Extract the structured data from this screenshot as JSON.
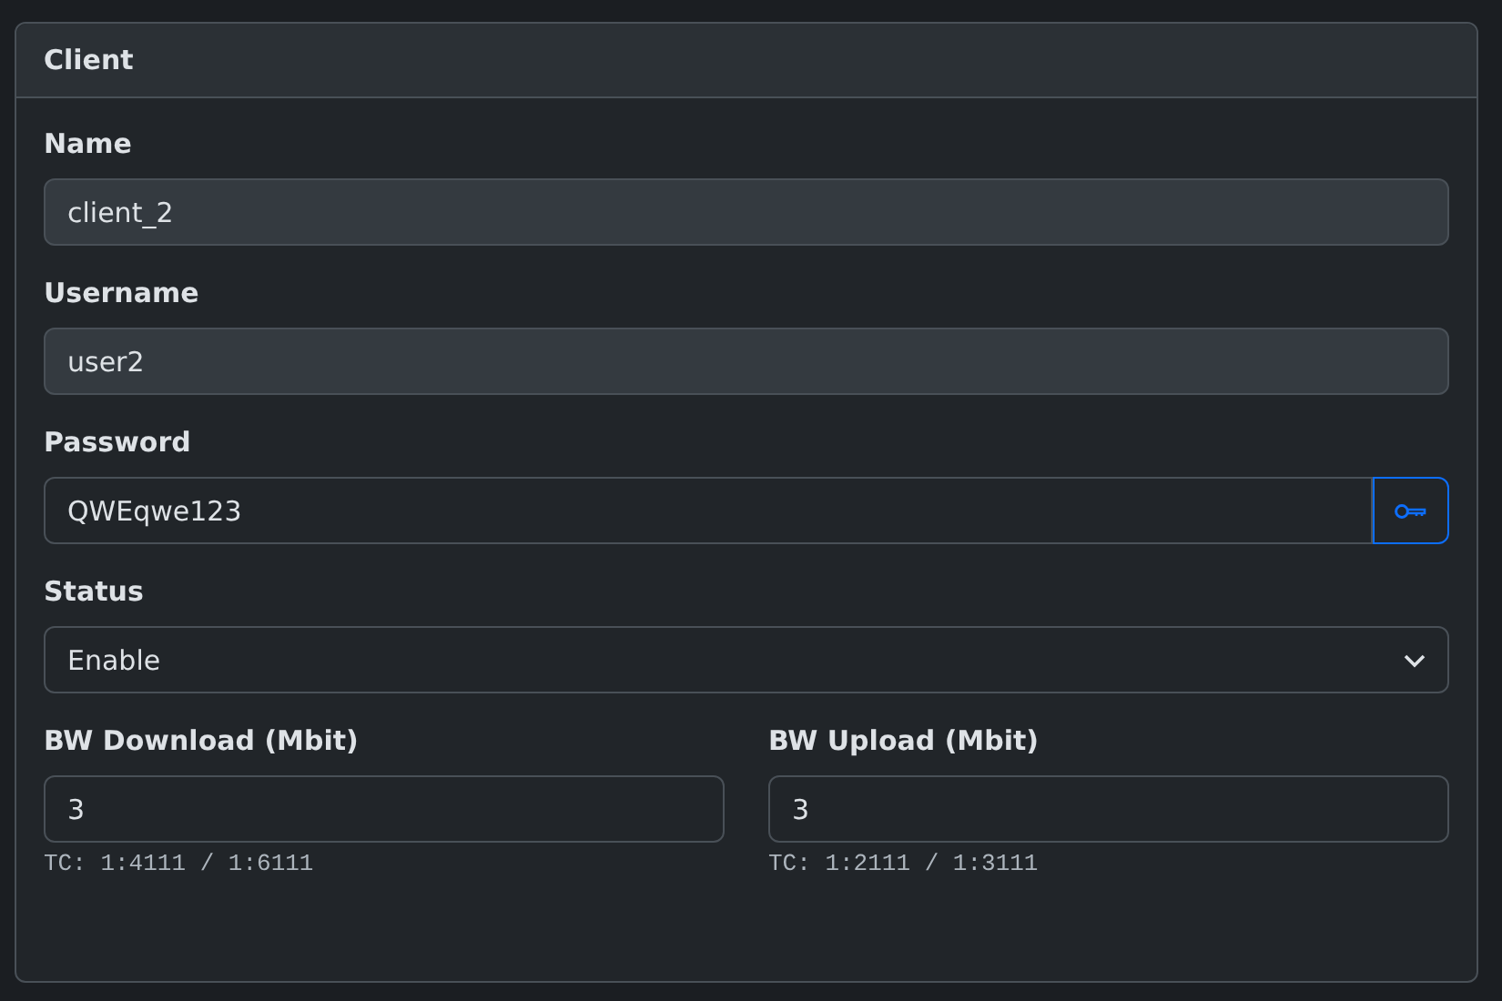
{
  "card": {
    "title": "Client"
  },
  "fields": [
    {
      "kind": "text",
      "label": "Name",
      "value": "client_2",
      "disabled": true
    },
    {
      "kind": "text",
      "label": "Username",
      "value": "user2",
      "disabled": true
    },
    {
      "kind": "password",
      "label": "Password",
      "value": "QWEqwe123",
      "disabled": false
    },
    {
      "kind": "select",
      "label": "Status",
      "value": "Enable",
      "disabled": false
    }
  ],
  "bandwidth": [
    {
      "label": "BW Download (Mbit)",
      "value": "3",
      "hint": "TC: 1:4111 / 1:6111"
    },
    {
      "label": "BW Upload (Mbit)",
      "value": "3",
      "hint": "TC: 1:2111 / 1:3111"
    }
  ]
}
